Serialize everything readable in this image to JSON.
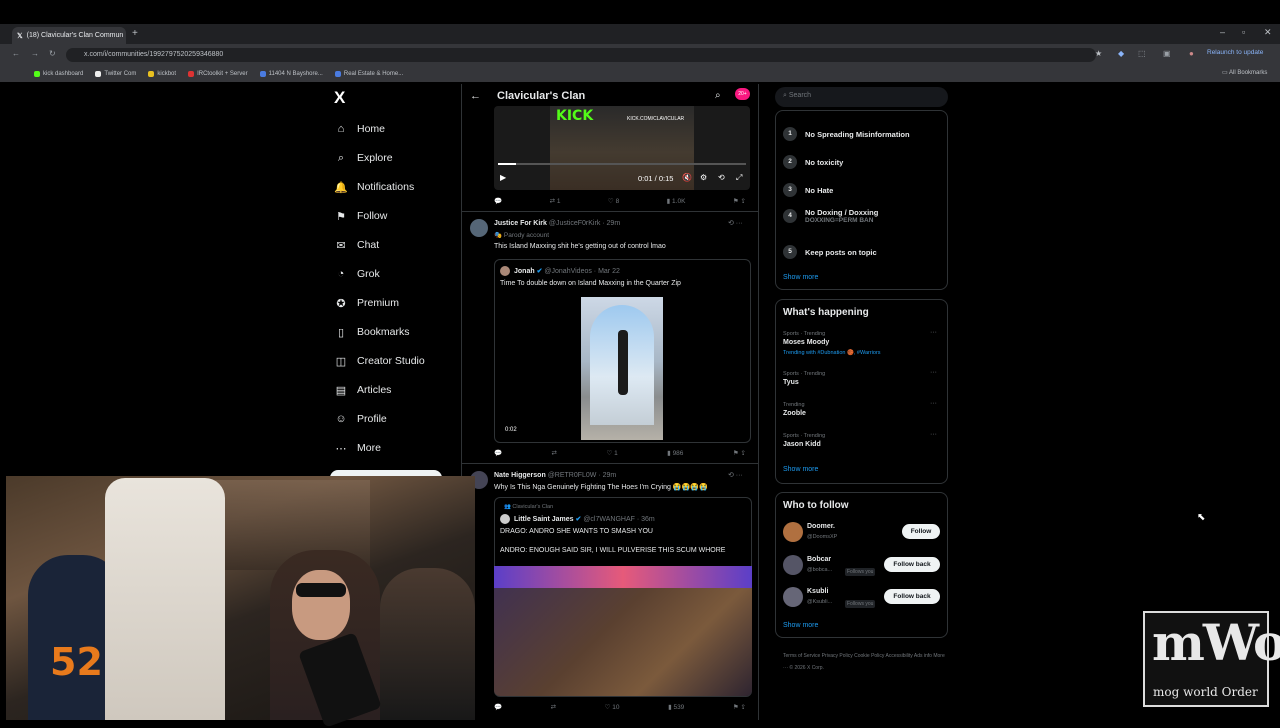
{
  "browser": {
    "tab_title": "(18) Clavicular's Clan Commun",
    "url": "x.com/i/communities/1992797520259346880",
    "relaunch": "Relaunch to update",
    "bookmarks": [
      "kick dashboard",
      "Twitter Com",
      "kickbot",
      "IRCtoolkit + Server",
      "11404 N Bayshore...",
      "Real Estate & Home..."
    ],
    "all_bookmarks": "All Bookmarks"
  },
  "nav": {
    "logo": "X",
    "items": [
      {
        "label": "Home",
        "icon": "home-icon"
      },
      {
        "label": "Explore",
        "icon": "search-icon"
      },
      {
        "label": "Notifications",
        "icon": "bell-icon"
      },
      {
        "label": "Follow",
        "icon": "follow-icon"
      },
      {
        "label": "Chat",
        "icon": "chat-icon"
      },
      {
        "label": "Grok",
        "icon": "grok-icon"
      },
      {
        "label": "Premium",
        "icon": "premium-icon"
      },
      {
        "label": "Bookmarks",
        "icon": "bookmark-icon"
      },
      {
        "label": "Creator Studio",
        "icon": "creator-studio-icon"
      },
      {
        "label": "Articles",
        "icon": "articles-icon"
      },
      {
        "label": "Profile",
        "icon": "profile-icon"
      },
      {
        "label": "More",
        "icon": "more-icon"
      }
    ]
  },
  "community": {
    "title": "Clavicular's Clan",
    "badge": "20+"
  },
  "video1": {
    "kick": "KICK",
    "kick_url": "KICK.COM/CLAVICULAR",
    "time": "0:01 / 0:15",
    "actions": [
      "",
      "1",
      "8",
      "1.0K",
      ""
    ]
  },
  "tweet1": {
    "name": "Justice For Kirk",
    "handle": "@JusticeF0rKirk · 29m",
    "parody": "Parody account",
    "text": "This Island Maxxing shit he's getting out of control lmao",
    "quote_name": "Jonah",
    "quote_handle": "@JonahVideos · Mar 22",
    "quote_text": "Time To double down on Island Maxxing in the Quarter Zip",
    "video_time": "0:02",
    "actions": [
      "",
      "",
      "1",
      "986",
      ""
    ]
  },
  "tweet2": {
    "name": "Nate Higgerson",
    "handle": "@RETR0FL0W · 29m",
    "text": "Why Is This Nga Genuinely Fighting The Hoes I'm Crying 😭😭😭😭",
    "quote_community": "Clavicular's Clan",
    "quote_name": "Little Saint James",
    "quote_handle": "@cl7WANGHAF · 36m",
    "quote_line1": "DRAGO: ANDRO SHE WANTS TO SMASH YOU",
    "quote_line2": "ANDRO: ENOUGH SAID SIR, I WILL PULVERISE THIS SCUM WHORE",
    "actions": [
      "",
      "",
      "10",
      "539",
      ""
    ]
  },
  "right": {
    "search_placeholder": "Search",
    "rules": [
      {
        "n": "1",
        "text": "No Spreading Misinformation",
        "sub": ""
      },
      {
        "n": "2",
        "text": "No toxicity",
        "sub": ""
      },
      {
        "n": "3",
        "text": "No Hate",
        "sub": ""
      },
      {
        "n": "4",
        "text": "No Doxing / Doxxing",
        "sub": "DOXXING=PERM BAN"
      },
      {
        "n": "5",
        "text": "Keep posts on topic",
        "sub": ""
      }
    ],
    "show_more": "Show more",
    "happening_title": "What's happening",
    "trends": [
      {
        "meta": "Sports · Trending",
        "name": "Moses Moody",
        "extra": "Trending with #Dubnation 🏀, #Warriors"
      },
      {
        "meta": "Sports · Trending",
        "name": "Tyus",
        "extra": ""
      },
      {
        "meta": "Trending",
        "name": "Zooble",
        "extra": ""
      },
      {
        "meta": "Sports · Trending",
        "name": "Jason Kidd",
        "extra": ""
      }
    ],
    "wtf_title": "Who to follow",
    "wtf": [
      {
        "name": "Doomer.",
        "handle": "@DoomsXP",
        "btn": "Follow",
        "tag": ""
      },
      {
        "name": "Bobcar",
        "handle": "@bobca...",
        "btn": "Follow back",
        "tag": "Follows you"
      },
      {
        "name": "Ksubli",
        "handle": "@Ksubli...",
        "btn": "Follow back",
        "tag": "Follows you"
      }
    ],
    "footer": "Terms of Service   Privacy Policy   Cookie Policy   Accessibility   Ads info   More ···   © 2026 X Corp."
  },
  "watermark": {
    "big": "mWo",
    "small": "mog world Order"
  },
  "colors": {
    "accent": "#1d9bf0",
    "kick": "#53fc18",
    "badge": "#f91880"
  }
}
